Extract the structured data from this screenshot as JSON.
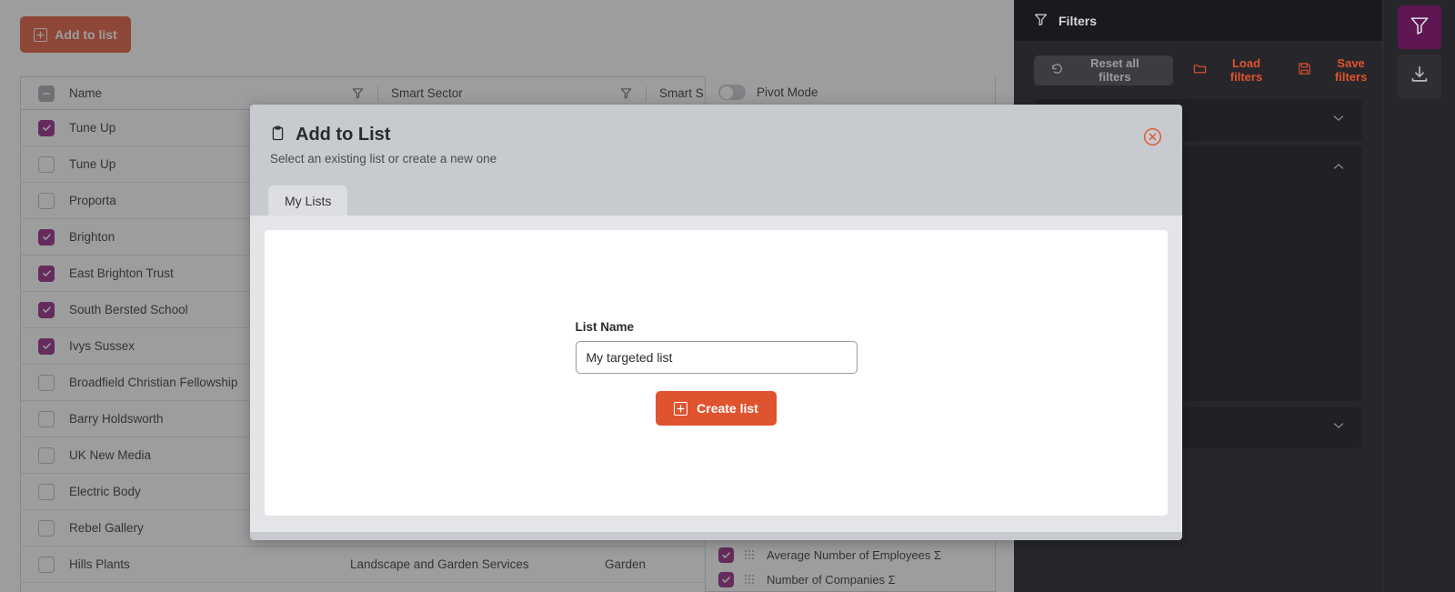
{
  "toolbar": {
    "add_to_list_label": "Add to list"
  },
  "grid": {
    "columns": [
      {
        "key": "name",
        "label": "Name"
      },
      {
        "key": "smart_sector",
        "label": "Smart Sector"
      },
      {
        "key": "smart_sector_2",
        "label": "Smart S"
      }
    ],
    "rows": [
      {
        "name": "Tune Up",
        "checked": true,
        "sector": "",
        "sector2": ""
      },
      {
        "name": "Tune Up",
        "checked": false,
        "sector": "",
        "sector2": ""
      },
      {
        "name": "Proporta",
        "checked": false,
        "sector": "",
        "sector2": ""
      },
      {
        "name": "Brighton",
        "checked": true,
        "sector": "",
        "sector2": ""
      },
      {
        "name": "East Brighton Trust",
        "checked": true,
        "sector": "",
        "sector2": ""
      },
      {
        "name": "South Bersted School",
        "checked": true,
        "sector": "",
        "sector2": ""
      },
      {
        "name": "Ivys Sussex",
        "checked": true,
        "sector": "",
        "sector2": ""
      },
      {
        "name": "Broadfield Christian Fellowship",
        "checked": false,
        "sector": "",
        "sector2": ""
      },
      {
        "name": "Barry Holdsworth",
        "checked": false,
        "sector": "",
        "sector2": ""
      },
      {
        "name": "UK New Media",
        "checked": false,
        "sector": "",
        "sector2": ""
      },
      {
        "name": "Electric Body",
        "checked": false,
        "sector": "",
        "sector2": ""
      },
      {
        "name": "Rebel Gallery",
        "checked": false,
        "sector": "",
        "sector2": ""
      },
      {
        "name": "Hills Plants",
        "checked": false,
        "sector": "Landscape and Garden Services",
        "sector2": "Garden"
      }
    ]
  },
  "column_panel": {
    "pivot_mode_label": "Pivot Mode",
    "pivot_mode_on": false,
    "items": [
      {
        "label": "Average Number of Employees Σ",
        "checked": true
      },
      {
        "label": "Number of Companies Σ",
        "checked": true
      }
    ]
  },
  "filters": {
    "title": "Filters",
    "reset_label": "Reset all filters",
    "load_label": "Load filters",
    "save_label": "Save filters"
  },
  "rail": {
    "filter_icon": "filter-icon",
    "download_icon": "download-icon"
  },
  "modal": {
    "title": "Add to List",
    "subtitle": "Select an existing list or create a new one",
    "tabs": [
      {
        "label": "My Lists",
        "active": true
      }
    ],
    "form": {
      "field_label": "List Name",
      "value": "My targeted list",
      "placeholder": "List name",
      "submit_label": "Create list"
    }
  },
  "colors": {
    "accent_orange": "#E0532F",
    "accent_purple": "#8E1A7D",
    "panel_dark": "#26262b",
    "modal_header": "#c7cbd0"
  }
}
